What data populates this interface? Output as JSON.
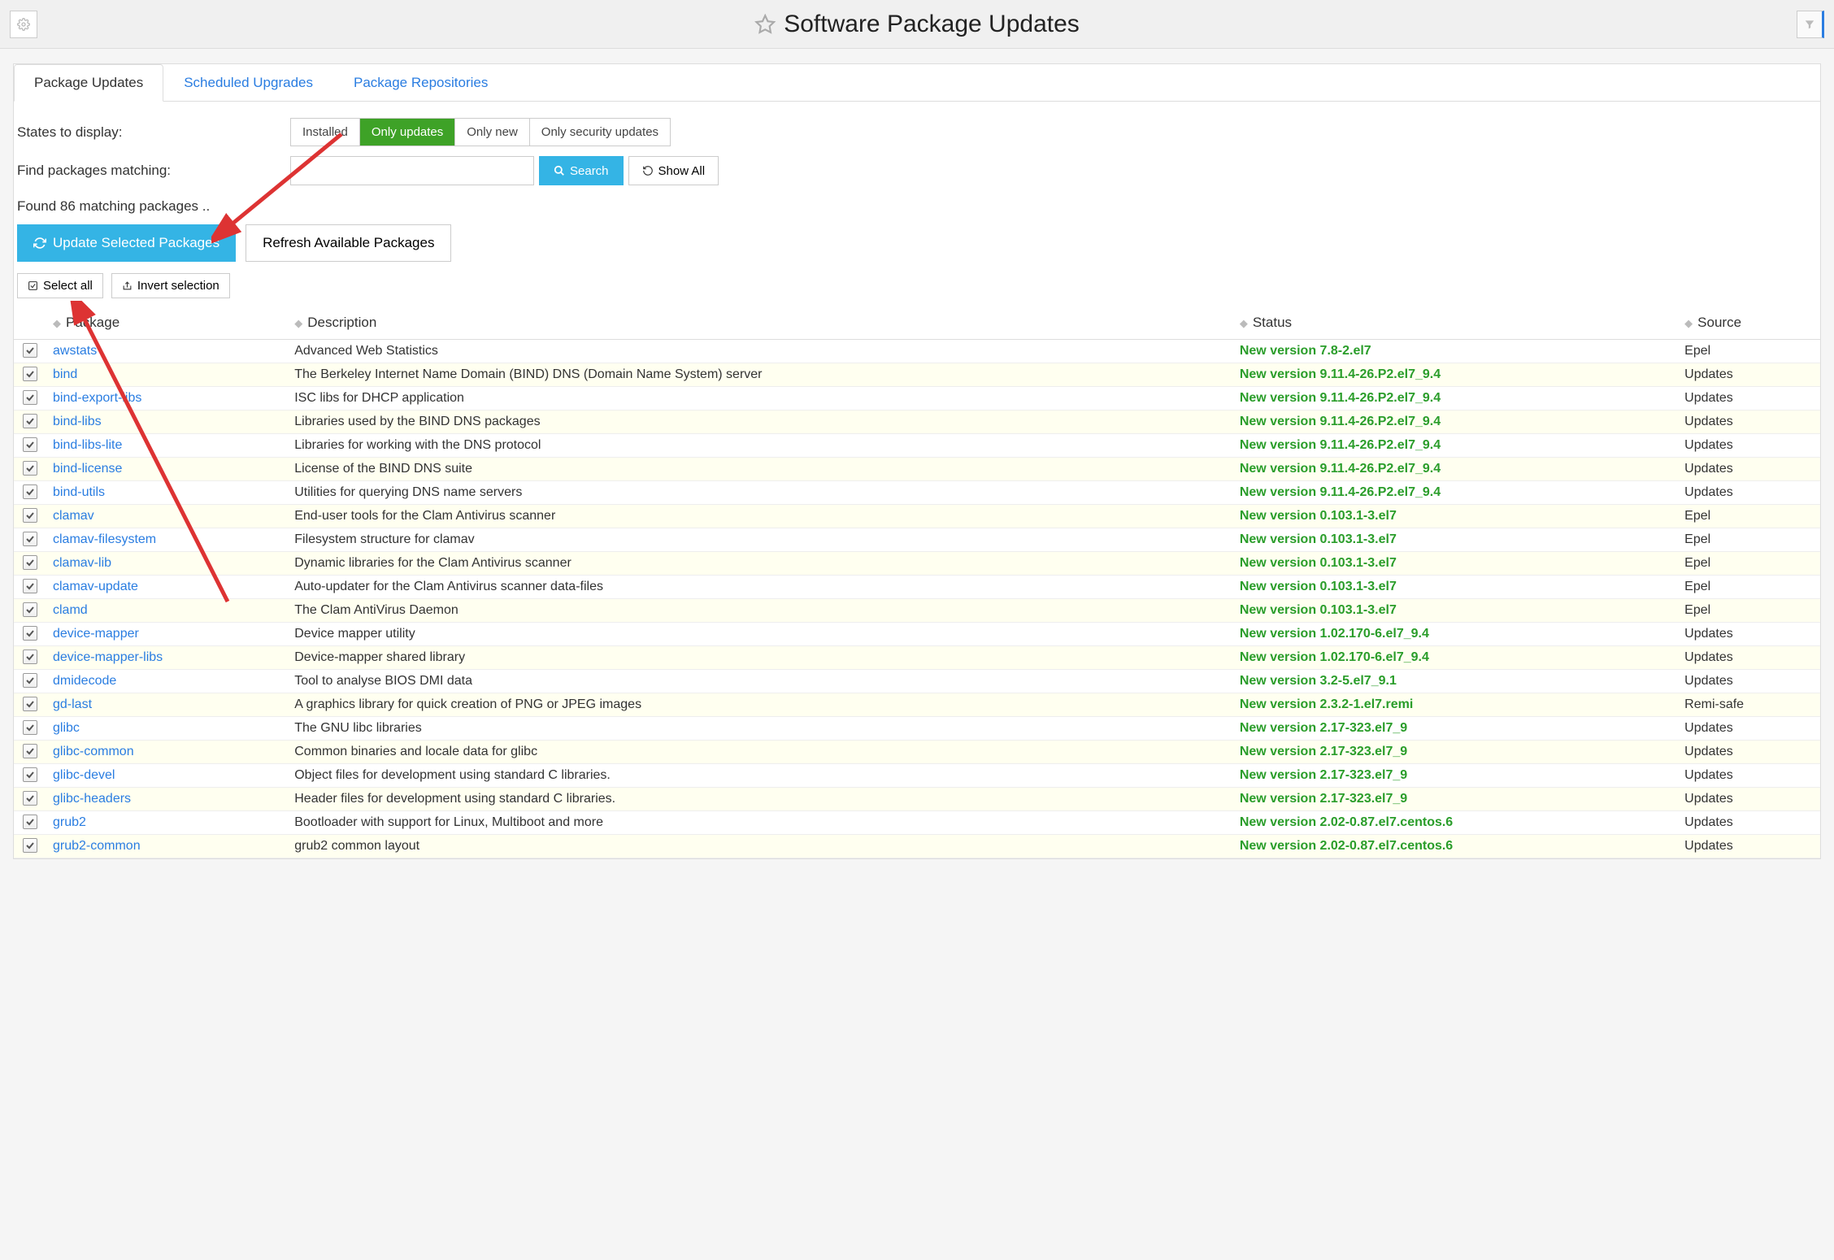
{
  "header": {
    "title": "Software Package Updates"
  },
  "tabs": [
    {
      "label": "Package Updates",
      "active": true
    },
    {
      "label": "Scheduled Upgrades",
      "active": false
    },
    {
      "label": "Package Repositories",
      "active": false
    }
  ],
  "states": {
    "label": "States to display:",
    "options": [
      "Installed",
      "Only updates",
      "Only new",
      "Only security updates"
    ],
    "active": "Only updates"
  },
  "search": {
    "label": "Find packages matching:",
    "value": "",
    "search_btn": "Search",
    "show_all_btn": "Show All"
  },
  "found_text": "Found 86 matching packages ..",
  "actions": {
    "update_selected": "Update Selected Packages",
    "refresh": "Refresh Available Packages"
  },
  "selection": {
    "select_all": "Select all",
    "invert": "Invert selection"
  },
  "columns": [
    "",
    "Package",
    "Description",
    "Status",
    "Source"
  ],
  "rows": [
    {
      "checked": true,
      "package": "awstats",
      "description": "Advanced Web Statistics",
      "status": "New version 7.8-2.el7",
      "source": "Epel"
    },
    {
      "checked": true,
      "package": "bind",
      "description": "The Berkeley Internet Name Domain (BIND) DNS (Domain Name System) server",
      "status": "New version 9.11.4-26.P2.el7_9.4",
      "source": "Updates"
    },
    {
      "checked": true,
      "package": "bind-export-libs",
      "description": "ISC libs for DHCP application",
      "status": "New version 9.11.4-26.P2.el7_9.4",
      "source": "Updates"
    },
    {
      "checked": true,
      "package": "bind-libs",
      "description": "Libraries used by the BIND DNS packages",
      "status": "New version 9.11.4-26.P2.el7_9.4",
      "source": "Updates"
    },
    {
      "checked": true,
      "package": "bind-libs-lite",
      "description": "Libraries for working with the DNS protocol",
      "status": "New version 9.11.4-26.P2.el7_9.4",
      "source": "Updates"
    },
    {
      "checked": true,
      "package": "bind-license",
      "description": "License of the BIND DNS suite",
      "status": "New version 9.11.4-26.P2.el7_9.4",
      "source": "Updates"
    },
    {
      "checked": true,
      "package": "bind-utils",
      "description": "Utilities for querying DNS name servers",
      "status": "New version 9.11.4-26.P2.el7_9.4",
      "source": "Updates"
    },
    {
      "checked": true,
      "package": "clamav",
      "description": "End-user tools for the Clam Antivirus scanner",
      "status": "New version 0.103.1-3.el7",
      "source": "Epel"
    },
    {
      "checked": true,
      "package": "clamav-filesystem",
      "description": "Filesystem structure for clamav",
      "status": "New version 0.103.1-3.el7",
      "source": "Epel"
    },
    {
      "checked": true,
      "package": "clamav-lib",
      "description": "Dynamic libraries for the Clam Antivirus scanner",
      "status": "New version 0.103.1-3.el7",
      "source": "Epel"
    },
    {
      "checked": true,
      "package": "clamav-update",
      "description": "Auto-updater for the Clam Antivirus scanner data-files",
      "status": "New version 0.103.1-3.el7",
      "source": "Epel"
    },
    {
      "checked": true,
      "package": "clamd",
      "description": "The Clam AntiVirus Daemon",
      "status": "New version 0.103.1-3.el7",
      "source": "Epel"
    },
    {
      "checked": true,
      "package": "device-mapper",
      "description": "Device mapper utility",
      "status": "New version 1.02.170-6.el7_9.4",
      "source": "Updates"
    },
    {
      "checked": true,
      "package": "device-mapper-libs",
      "description": "Device-mapper shared library",
      "status": "New version 1.02.170-6.el7_9.4",
      "source": "Updates"
    },
    {
      "checked": true,
      "package": "dmidecode",
      "description": "Tool to analyse BIOS DMI data",
      "status": "New version 3.2-5.el7_9.1",
      "source": "Updates"
    },
    {
      "checked": true,
      "package": "gd-last",
      "description": "A graphics library for quick creation of PNG or JPEG images",
      "status": "New version 2.3.2-1.el7.remi",
      "source": "Remi-safe"
    },
    {
      "checked": true,
      "package": "glibc",
      "description": "The GNU libc libraries",
      "status": "New version 2.17-323.el7_9",
      "source": "Updates"
    },
    {
      "checked": true,
      "package": "glibc-common",
      "description": "Common binaries and locale data for glibc",
      "status": "New version 2.17-323.el7_9",
      "source": "Updates"
    },
    {
      "checked": true,
      "package": "glibc-devel",
      "description": "Object files for development using standard C libraries.",
      "status": "New version 2.17-323.el7_9",
      "source": "Updates"
    },
    {
      "checked": true,
      "package": "glibc-headers",
      "description": "Header files for development using standard C libraries.",
      "status": "New version 2.17-323.el7_9",
      "source": "Updates"
    },
    {
      "checked": true,
      "package": "grub2",
      "description": "Bootloader with support for Linux, Multiboot and more",
      "status": "New version 2.02-0.87.el7.centos.6",
      "source": "Updates"
    },
    {
      "checked": true,
      "package": "grub2-common",
      "description": "grub2 common layout",
      "status": "New version 2.02-0.87.el7.centos.6",
      "source": "Updates"
    }
  ]
}
